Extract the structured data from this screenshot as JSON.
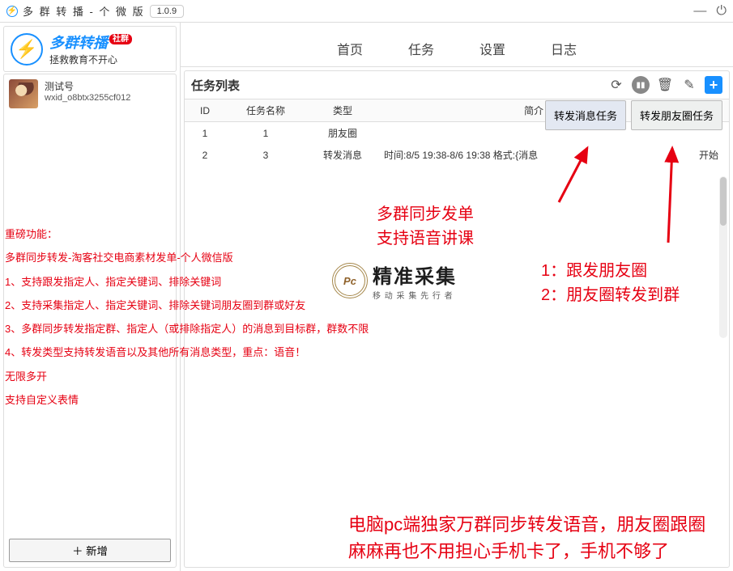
{
  "titlebar": {
    "app_name": "多 群 转 播 - 个 微 版",
    "version": "1.0.9"
  },
  "brand": {
    "line1": "多群转播",
    "badge": "社群",
    "line2": "拯救教育不开心"
  },
  "user": {
    "nickname": "测试号",
    "wxid": "wxid_o8btx3255cf012"
  },
  "sidebar": {
    "add_button": "＋ 新增"
  },
  "tabs": {
    "home": "首页",
    "tasks": "任务",
    "settings": "设置",
    "logs": "日志"
  },
  "panel": {
    "title": "任务列表",
    "headers": {
      "id": "ID",
      "name": "任务名称",
      "type": "类型",
      "desc": "简介"
    },
    "rows": [
      {
        "id": "1",
        "name": "1",
        "type": "朋友圈",
        "desc": ""
      },
      {
        "id": "2",
        "name": "3",
        "type": "转发消息",
        "desc": "时间:8/5 19:38-8/6 19:38 格式:{消息",
        "tail": "开始"
      }
    ],
    "float_buttons": {
      "btn1": "转发消息任务",
      "btn2": "转发朋友圈任务"
    }
  },
  "annotations": {
    "center1": "多群同步发单",
    "center2": "支持语音讲课",
    "right1": "1：跟发朋友圈",
    "right2": "2：朋友圈转发到群",
    "left_block": {
      "l1": "重磅功能：",
      "l2": "多群同步转发-淘客社交电商素材发单-个人微信版",
      "l3": "1、支持跟发指定人、指定关键词、排除关键词",
      "l4": "2、支持采集指定人、指定关键词、排除关键词朋友圈到群或好友",
      "l5": "3、多群同步转发指定群、指定人（或排除指定人）的消息到目标群，群数不限",
      "l6": "4、转发类型支持转发语音以及其他所有消息类型，重点：语音！",
      "l7": "无限多开",
      "l8": "支持自定义表情"
    },
    "bottom1": "电脑pc端独家万群同步转发语音，朋友圈跟圈",
    "bottom2": "麻麻再也不用担心手机卡了，手机不够了"
  },
  "watermark": {
    "circle": "Pc",
    "big": "精准采集",
    "small": "移 动 采 集 先 行 者"
  }
}
